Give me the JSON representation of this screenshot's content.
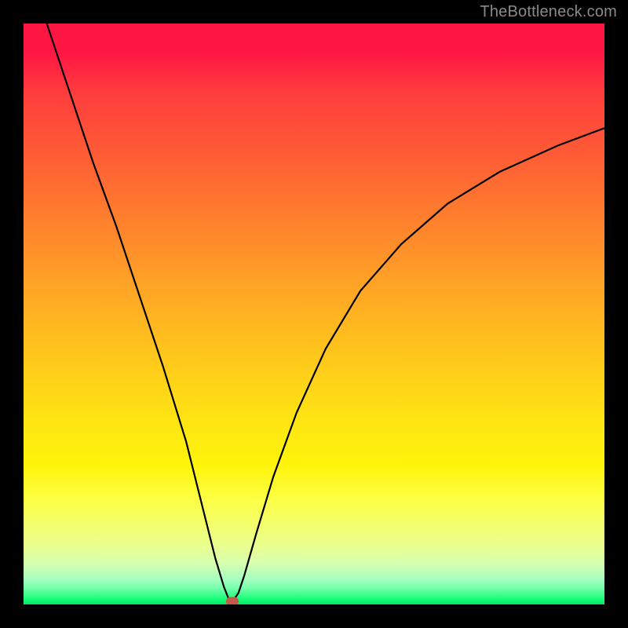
{
  "watermark": "TheBottleneck.com",
  "chart_data": {
    "type": "line",
    "title": "",
    "xlabel": "",
    "ylabel": "",
    "xlim": [
      0,
      100
    ],
    "ylim": [
      0,
      100
    ],
    "grid": false,
    "series": [
      {
        "name": "bottleneck-curve",
        "x": [
          4,
          8,
          12,
          16,
          20,
          24,
          28,
          31,
          33,
          34.5,
          35.5,
          36,
          37,
          38,
          40,
          43,
          47,
          52,
          58,
          65,
          73,
          82,
          92,
          100
        ],
        "values": [
          100,
          88,
          76,
          65,
          53,
          41,
          28,
          16,
          8,
          3,
          0.5,
          0.5,
          2,
          5,
          12,
          22,
          33,
          44,
          54,
          62,
          69,
          74.5,
          79,
          82
        ]
      }
    ],
    "marker": {
      "x": 36,
      "y": 0.5
    },
    "gradient_stops": [
      {
        "pct": 0,
        "color": "#ff1744"
      },
      {
        "pct": 100,
        "color": "#00e868"
      }
    ]
  }
}
